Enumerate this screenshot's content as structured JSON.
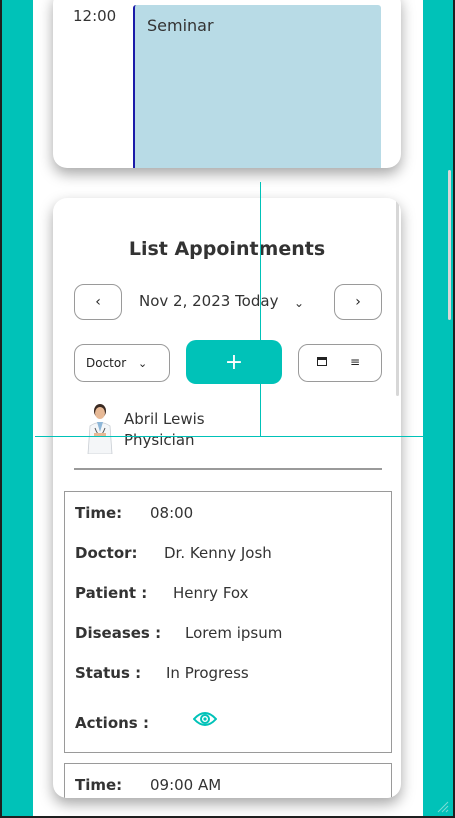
{
  "calendar": {
    "time_label": "12:00",
    "event_title": "Seminar"
  },
  "appointments_card": {
    "title": "List Appointments",
    "date_label": "Nov 2, 2023 Today",
    "prev_label": "‹",
    "next_label": "›",
    "doctor_select": "Doctor",
    "add_label": "+",
    "view_icons": [
      "calendar-icon",
      "list-icon"
    ],
    "doctor": {
      "name": "Abril Lewis",
      "role": "Physician"
    },
    "field_labels": {
      "time": "Time:",
      "doctor": "Doctor:",
      "patient": "Patient :",
      "diseases": "Diseases :",
      "status": "Status :",
      "actions": "Actions :"
    },
    "appointments": [
      {
        "time": "08:00",
        "doctor": "Dr. Kenny Josh",
        "patient": "Henry Fox",
        "diseases": "Lorem ipsum",
        "status": "In Progress"
      },
      {
        "time": "09:00 AM"
      }
    ]
  },
  "colors": {
    "accent": "#00c2b8",
    "event_bg": "#b8dbe6",
    "event_border": "#1a1aa8"
  }
}
